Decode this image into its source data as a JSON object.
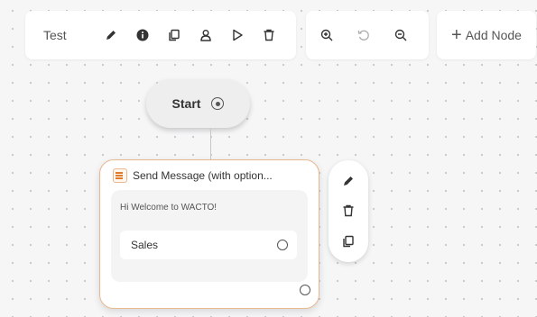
{
  "toolbar": {
    "flow_name": "Test",
    "icons": [
      "pencil-icon",
      "info-icon",
      "copy-icon",
      "user-icon",
      "play-icon",
      "trash-icon"
    ]
  },
  "zoom_toolbar": {
    "icons": [
      "zoom-in-icon",
      "reset-zoom-icon",
      "zoom-out-icon"
    ]
  },
  "add_node": {
    "icon": "plus-icon",
    "label": "Add Node"
  },
  "start_node": {
    "label": "Start",
    "icon": "radio-icon"
  },
  "message_node": {
    "icon": "list-icon",
    "title": "Send Message (with option...",
    "message": "Hi Welcome to WACTO!",
    "options": [
      {
        "label": "Sales"
      }
    ]
  },
  "node_actions": {
    "icons": [
      "pencil-icon",
      "trash-icon",
      "copy-icon"
    ]
  },
  "colors": {
    "accent": "#e8b890",
    "accent_dark": "#e07b2c",
    "icon": "#333333"
  }
}
